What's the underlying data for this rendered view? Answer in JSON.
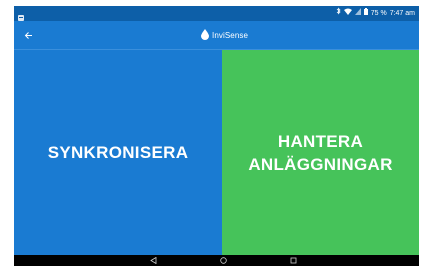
{
  "status_bar": {
    "time": "7:47 am",
    "battery": "75 %",
    "icons": [
      "notification-icon",
      "bluetooth-icon",
      "wifi-icon",
      "signal-icon",
      "battery-icon"
    ]
  },
  "app_bar": {
    "brand": "InviSense",
    "back_icon": "arrow-back-icon",
    "logo_icon": "water-drop-icon"
  },
  "tiles": {
    "sync": {
      "label": "SYNKRONISERA",
      "color": "#1a7bd2"
    },
    "manage": {
      "label_line1": "HANTERA",
      "label_line2": "ANLÄGGNINGAR",
      "color": "#46c35a"
    }
  },
  "nav_bar": {
    "icons": [
      "back-triangle-icon",
      "home-circle-icon",
      "recents-square-icon"
    ]
  },
  "colors": {
    "status_bar": "#0d5fa8",
    "app_bar": "#1a7bd2",
    "nav_bar": "#000000"
  }
}
